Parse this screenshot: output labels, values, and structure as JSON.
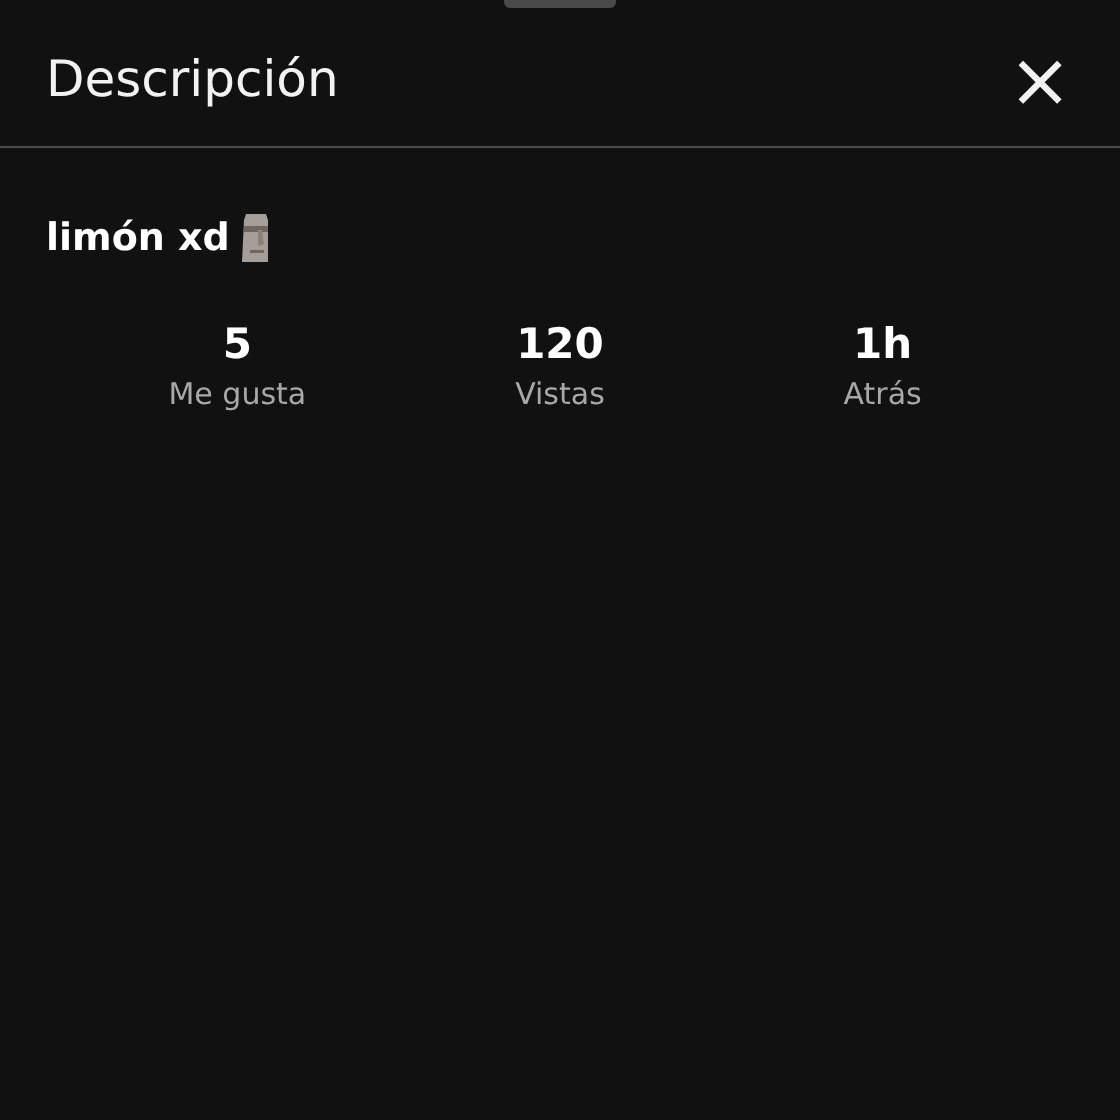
{
  "header": {
    "title": "Descripción",
    "close": "×"
  },
  "description": {
    "text": "limón xd"
  },
  "stats": [
    {
      "value": "5",
      "label": "Me gusta"
    },
    {
      "value": "120",
      "label": "Vistas"
    },
    {
      "value": "1h",
      "label": "Atrás"
    }
  ]
}
